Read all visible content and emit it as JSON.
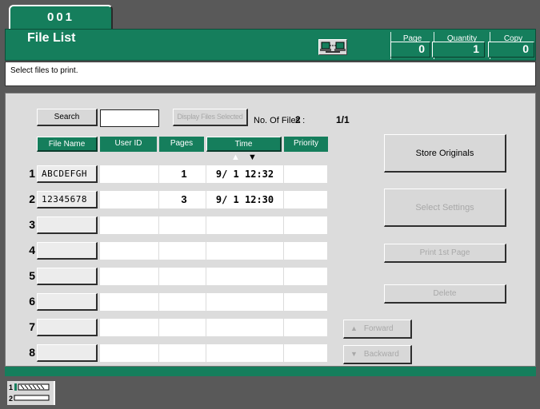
{
  "job_tab": {
    "number": "001"
  },
  "header": {
    "title": "File List",
    "page": {
      "label": "Page",
      "value": "0"
    },
    "quantity": {
      "label": "Quantity",
      "value": "1"
    },
    "copy": {
      "label": "Copy",
      "value": "0"
    }
  },
  "message": "Select files to print.",
  "toolbar": {
    "search_label": "Search",
    "search_value": "",
    "display_selected_label": "Display Files Selected",
    "num_files_label": "No. Of Files :",
    "num_files_value": "2",
    "page_fraction": "1/1"
  },
  "table": {
    "headers": {
      "file_name": "File Name",
      "user_id": "User ID",
      "pages": "Pages",
      "time": "Time",
      "priority": "Priority"
    },
    "sort": {
      "up": "▲",
      "down": "▼"
    },
    "rows": [
      {
        "num": "1",
        "file_name": "ABCDEFGH",
        "user_id": "",
        "pages": "1",
        "time": "9/ 1 12:32",
        "priority": ""
      },
      {
        "num": "2",
        "file_name": "12345678",
        "user_id": "",
        "pages": "3",
        "time": "9/ 1 12:30",
        "priority": ""
      },
      {
        "num": "3",
        "file_name": "",
        "user_id": "",
        "pages": "",
        "time": "",
        "priority": ""
      },
      {
        "num": "4",
        "file_name": "",
        "user_id": "",
        "pages": "",
        "time": "",
        "priority": ""
      },
      {
        "num": "5",
        "file_name": "",
        "user_id": "",
        "pages": "",
        "time": "",
        "priority": ""
      },
      {
        "num": "6",
        "file_name": "",
        "user_id": "",
        "pages": "",
        "time": "",
        "priority": ""
      },
      {
        "num": "7",
        "file_name": "",
        "user_id": "",
        "pages": "",
        "time": "",
        "priority": ""
      },
      {
        "num": "8",
        "file_name": "",
        "user_id": "",
        "pages": "",
        "time": "",
        "priority": ""
      }
    ]
  },
  "actions": {
    "store_originals": "Store Originals",
    "select_settings": "Select Settings",
    "print_first_page": "Print 1st Page",
    "delete": "Delete",
    "forward": "Forward",
    "backward": "Backward",
    "forward_icon": "▲",
    "backward_icon": "▼"
  },
  "status": {
    "line1": "1",
    "line2": "2"
  },
  "colors": {
    "accent": "#157e5c",
    "panel": "#dcdcdc",
    "frame": "#595959"
  }
}
